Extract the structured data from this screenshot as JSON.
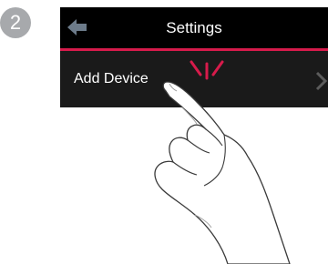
{
  "step_badge": {
    "number": "2"
  },
  "header": {
    "title": "Settings",
    "back_icon": "arrow-left-icon"
  },
  "menu": {
    "items": [
      {
        "label": "Add Device",
        "icon": "chevron-right-icon"
      }
    ]
  },
  "colors": {
    "accent": "#d71b4b",
    "header_bg": "#000000",
    "screen_bg": "#1a1a1a",
    "badge_bg": "#a7a9ac"
  }
}
